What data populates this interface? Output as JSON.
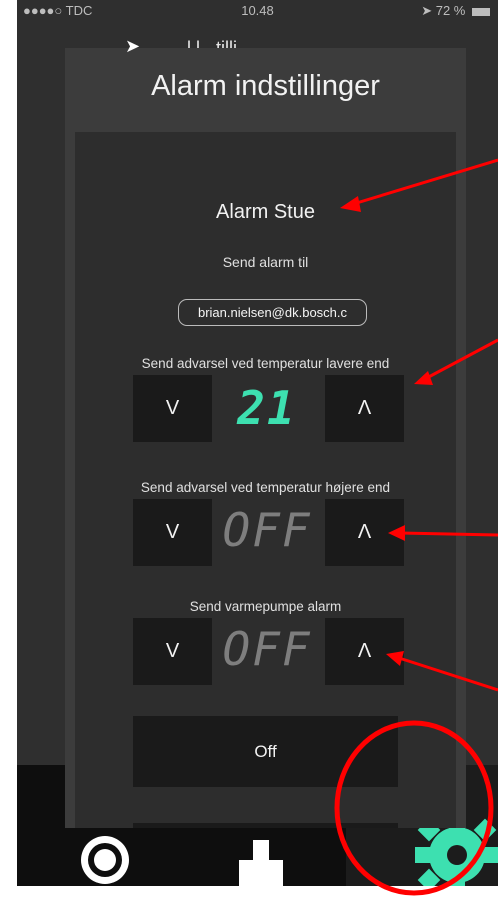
{
  "status_bar": {
    "carrier": "●●●●○ TDC",
    "wifi_icon": "wifi-icon",
    "time": "10.48",
    "right": "72 %"
  },
  "background_title": "l  l  ·  tilli",
  "modal": {
    "title": "Alarm indstillinger",
    "alarm_name": "Alarm Stue",
    "send_to_label": "Send alarm til",
    "email": "brian.nielsen@dk.bosch.c",
    "low_temp": {
      "label": "Send advarsel ved temperatur lavere end",
      "value": "21",
      "down": "V",
      "up": "Λ"
    },
    "high_temp": {
      "label": "Send advarsel ved temperatur højere end",
      "value": "OFF",
      "down": "V",
      "up": "Λ"
    },
    "heatpump_alarm": {
      "label": "Send varmepumpe alarm",
      "value": "OFF",
      "down": "V",
      "up": "Λ"
    },
    "off_button": "Off"
  },
  "colors": {
    "accent": "#3de0b0",
    "annotation": "#ff0000",
    "modal": "#3c3c3c",
    "panel": "#2d2d2d",
    "button": "#1a1a1a"
  },
  "tabbar": {
    "icons": [
      "disc-icon",
      "flask-icon",
      "gear-icon"
    ]
  }
}
